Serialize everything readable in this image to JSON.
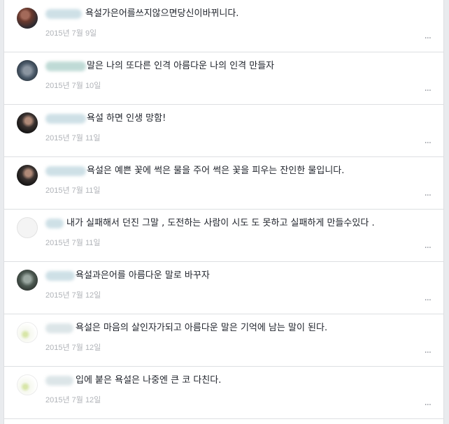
{
  "comments": [
    {
      "text": "욕설가은어를쓰지않으면당신이바뀌니다.",
      "date": "2015년 7월 9일"
    },
    {
      "text": "말은 나의 또다른 인격 아름다운 나의 인격 만들자",
      "date": "2015년 7월 10일"
    },
    {
      "text": "욕설 하면 인생 망함!",
      "date": "2015년 7월 11일"
    },
    {
      "text": "욕설은 예쁜 꽃에 썩은 물을 주어 썩은 꽃을 피우는 잔인한 물입니다.",
      "date": "2015년 7월 11일"
    },
    {
      "text": "내가 실패해서 던진 그말 , 도전하는 사람이 시도 도 못하고 실패하게 만들수있다 .",
      "date": "2015년 7월 11일"
    },
    {
      "text": "욕설과은어를 아름다운 말로 바꾸자",
      "date": "2015년 7월 12일"
    },
    {
      "text": "욕설은 마음의 살인자가되고 아름다운 말은 기억에 남는 말이 된다.",
      "date": "2015년 7월 12일"
    },
    {
      "text": "입에 붙은 욕설은 나중엔 큰 코 다친다.",
      "date": "2015년 7월 12일"
    }
  ],
  "more_icon": "···",
  "colors": {
    "text": "#1d2129",
    "date": "#b0b3b8",
    "blur_name": "#c9dde4",
    "border": "#dddfe2"
  }
}
